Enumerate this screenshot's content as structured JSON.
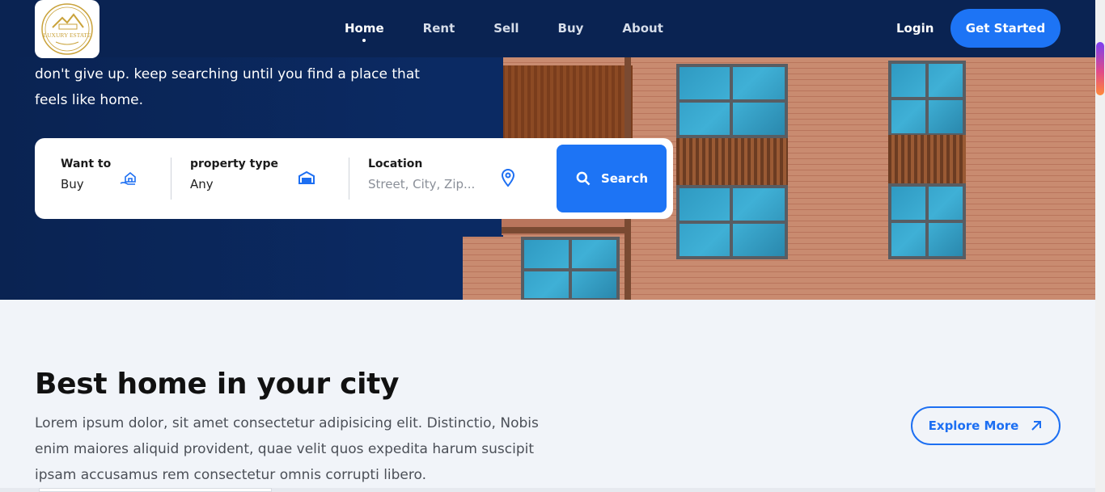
{
  "nav": {
    "logo_text": "LUXURY ESTATE",
    "links": [
      {
        "label": "Home",
        "active": true
      },
      {
        "label": "Rent",
        "active": false
      },
      {
        "label": "Sell",
        "active": false
      },
      {
        "label": "Buy",
        "active": false
      },
      {
        "label": "About",
        "active": false
      }
    ],
    "login_label": "Login",
    "cta_label": "Get Started"
  },
  "hero": {
    "tagline": "don't give up. keep searching until you find a place that feels like home."
  },
  "search": {
    "want_to": {
      "label": "Want to",
      "value": "Buy",
      "icon": "hand-house-icon"
    },
    "property_type": {
      "label": "property type",
      "value": "Any",
      "icon": "house-icon"
    },
    "location": {
      "label": "Location",
      "placeholder": "Street, City, Zip...",
      "icon": "map-pin-icon"
    },
    "button_label": "Search"
  },
  "section": {
    "title": "Best home in your city",
    "body": "Lorem ipsum dolor, sit amet consectetur adipisicing elit. Distinctio, Nobis enim maiores aliquid provident, quae velit quos expedita harum suscipit ipsam accusamus rem consectetur omnis corrupti libero.",
    "explore_label": "Explore More"
  },
  "colors": {
    "nav_bg": "#0a2352",
    "accent": "#1d74f5",
    "page_bg": "#f1f4f9"
  }
}
